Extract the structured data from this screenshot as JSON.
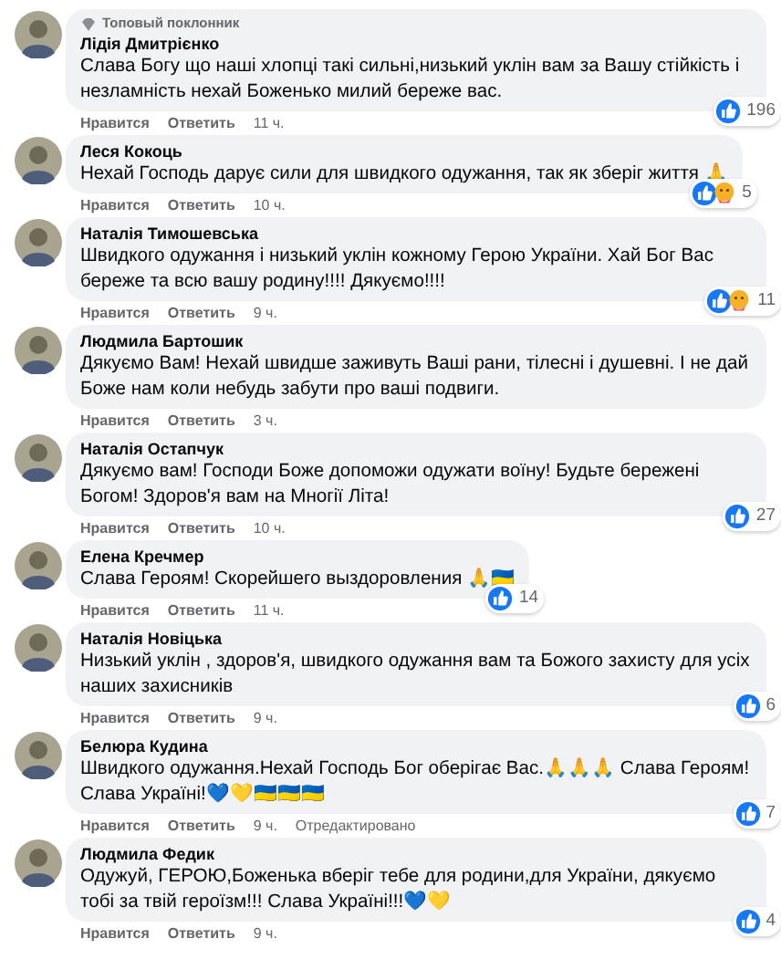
{
  "comments": [
    {
      "badge": "Топовый поклонник",
      "author": "Лідія Дмитрієнко",
      "text": "Слава Богу що наші хлопці такі сильні,низький уклін вам за Вашу стійкість і незламність нехай Боженько милий береже вас.",
      "care": false,
      "count": "196",
      "like": "Нравится",
      "reply": "Ответить",
      "time": "11 ч."
    },
    {
      "author": "Леся Кокоць",
      "text": "Нехай Господь дарує сили для швидкого одужання, так як зберіг життя 🙏",
      "care": true,
      "count": "5",
      "like": "Нравится",
      "reply": "Ответить",
      "time": "10 ч."
    },
    {
      "author": "Наталія Тимошевська",
      "text": "Швидкого одужання і низький уклін кожному Герою України. Хай Бог Вас береже та всю вашу родину!!!! Дякуємо!!!!",
      "care": true,
      "count": "11",
      "like": "Нравится",
      "reply": "Ответить",
      "time": "9 ч."
    },
    {
      "author": "Людмила Бартошик",
      "text": "Дякуємо Вам! Нехай швидше заживуть Ваші рани, тілесні і душевні. І не дай Боже нам коли небудь забути про ваші подвиги.",
      "like": "Нравится",
      "reply": "Ответить",
      "time": "3 ч."
    },
    {
      "author": "Наталія Остапчук",
      "text": "Дякуємо вам! Господи Боже допоможи одужати воїну! Будьте бережені Богом! Здоров'я вам на Многії Літа!",
      "care": false,
      "count": "27",
      "like": "Нравится",
      "reply": "Ответить",
      "time": "10 ч."
    },
    {
      "author": "Елена Кречмер",
      "text": "Слава Героям! Скорейшего выздоровления 🙏🇺🇦",
      "care": false,
      "count": "14",
      "like": "Нравится",
      "reply": "Ответить",
      "time": "11 ч."
    },
    {
      "author": "Наталія Новіцька",
      "text": "Низький уклін , здоров'я, швидкого одужання вам та Божого захисту для усіх наших захисників",
      "care": false,
      "count": "6",
      "like": "Нравится",
      "reply": "Ответить",
      "time": "9 ч."
    },
    {
      "author": "Белюра Кудина",
      "text": "Швидкого одужання.Нехай Господь Бог оберігає Вас.🙏🙏🙏 Слава Героям! Слава Україні!💙💛🇺🇦🇺🇦🇺🇦",
      "care": false,
      "count": "7",
      "like": "Нравится",
      "reply": "Ответить",
      "time": "9 ч.",
      "edited": "Отредактировано"
    },
    {
      "author": "Людмила Федик",
      "text": "Одужуй, ГЕРОЮ,Боженька вберіг тебе для родини,для України, дякуємо тобі за твій героїзм!!! Слава Україні!!!💙💛",
      "care": false,
      "count": "4",
      "like": "Нравится",
      "reply": "Ответить",
      "time": "9 ч."
    }
  ]
}
